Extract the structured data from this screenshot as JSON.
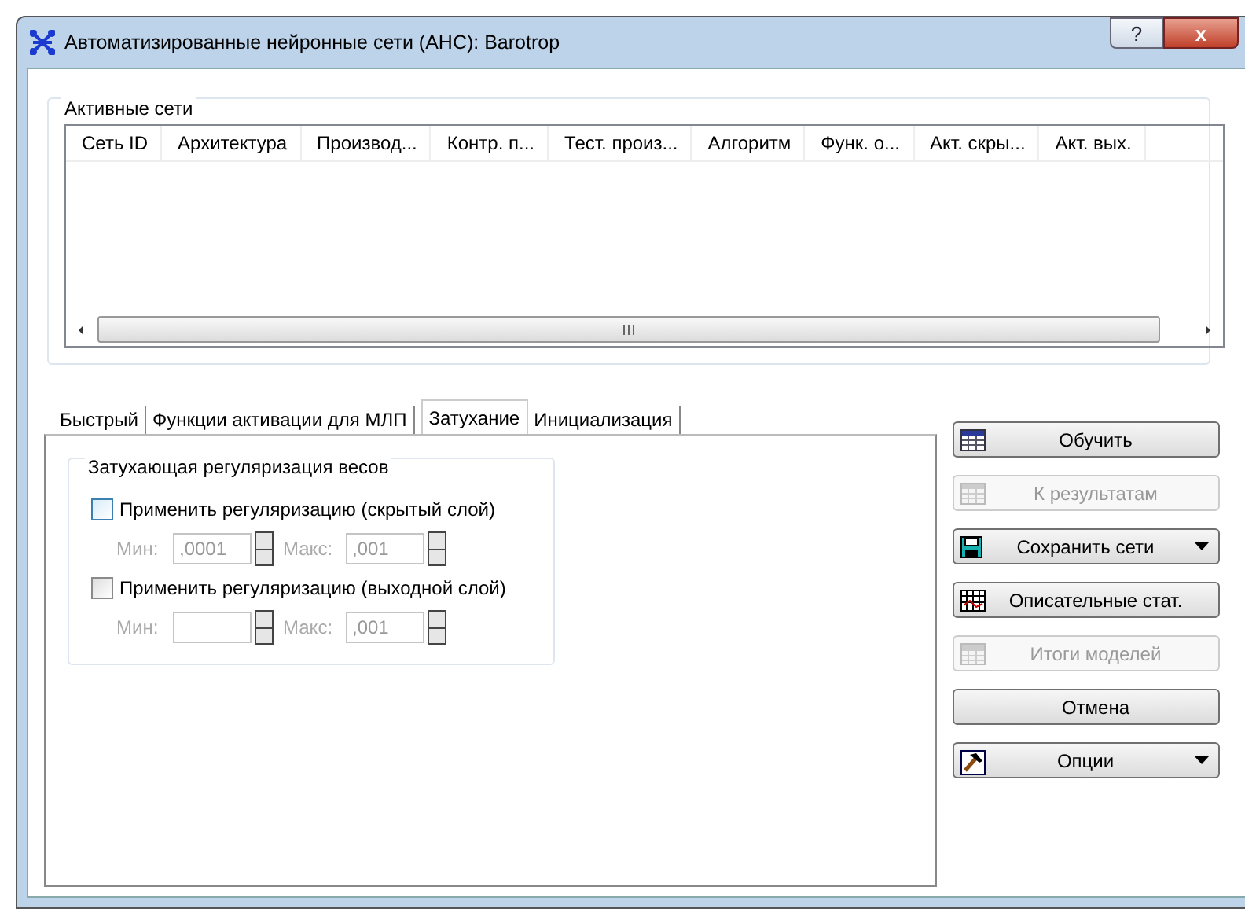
{
  "window": {
    "title": "Автоматизированные нейронные сети (АНС): Barotrop",
    "help": "?",
    "close": "x"
  },
  "active_networks": {
    "title": "Активные сети",
    "columns": [
      "Сеть ID",
      "Архитектура",
      "Производ...",
      "Контр. п...",
      "Тест. произ...",
      "Алгоритм",
      "Функ. о...",
      "Акт. скры...",
      "Акт. вых."
    ]
  },
  "tabs": [
    {
      "label": "Быстрый",
      "selected": false
    },
    {
      "label": "Функции активации для МЛП",
      "selected": false
    },
    {
      "label": "Затухание",
      "selected": true
    },
    {
      "label": "Инициализация",
      "selected": false
    }
  ],
  "decay": {
    "title": "Затухающая регуляризация весов",
    "options": [
      {
        "label": "Применить регуляризацию (скрытый слой)",
        "checked": false,
        "focused": true,
        "min_label": "Мин:",
        "min_value": ",0001",
        "max_label": "Макс:",
        "max_value": ",001"
      },
      {
        "label": "Применить регуляризацию (выходной слой)",
        "checked": false,
        "focused": false,
        "min_label": "Мин:",
        "max_label": "Макс:",
        "max_value": ",001"
      }
    ]
  },
  "buttons": [
    {
      "label": "Обучить",
      "disabled": false,
      "dropdown": false,
      "kind": "table"
    },
    {
      "label": "К результатам",
      "disabled": true,
      "dropdown": false,
      "kind": "table"
    },
    {
      "label": "Сохранить сети",
      "disabled": false,
      "dropdown": true,
      "kind": "disk"
    },
    {
      "label": "Описательные стат.",
      "disabled": false,
      "dropdown": false,
      "kind": "grid"
    },
    {
      "label": "Итоги моделей",
      "disabled": true,
      "dropdown": false,
      "kind": "sum"
    },
    {
      "label": "Отмена",
      "disabled": false,
      "dropdown": false,
      "kind": "plain"
    },
    {
      "label": "Опции",
      "disabled": false,
      "dropdown": true,
      "kind": "hammer"
    }
  ]
}
